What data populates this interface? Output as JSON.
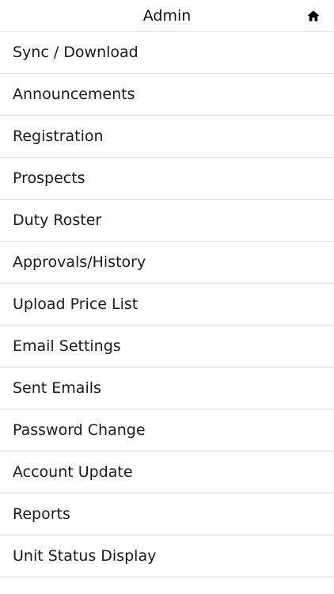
{
  "header": {
    "title": "Admin",
    "home_icon": "home-icon"
  },
  "menu": {
    "items": [
      {
        "label": "Sync / Download"
      },
      {
        "label": "Announcements"
      },
      {
        "label": "Registration"
      },
      {
        "label": "Prospects"
      },
      {
        "label": "Duty Roster"
      },
      {
        "label": "Approvals/History"
      },
      {
        "label": "Upload Price List"
      },
      {
        "label": "Email Settings"
      },
      {
        "label": "Sent Emails"
      },
      {
        "label": "Password Change"
      },
      {
        "label": "Account Update"
      },
      {
        "label": "Reports"
      },
      {
        "label": "Unit Status Display"
      }
    ]
  },
  "colors": {
    "background": "#ffffff",
    "text": "#1a1a1a",
    "divider": "#dadada"
  }
}
